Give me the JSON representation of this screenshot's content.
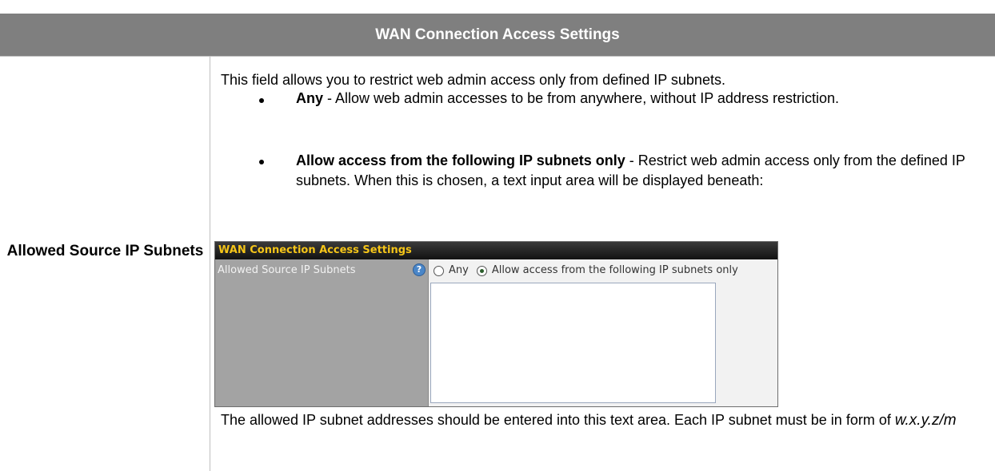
{
  "section_title": "WAN Connection Access Settings",
  "field_label": "Allowed Source IP Subnets",
  "intro": "This field allows you to restrict web admin access only from defined IP subnets.",
  "options": [
    {
      "name": "Any",
      "desc": " - Allow web admin accesses to be from anywhere, without IP address restriction."
    },
    {
      "name": "Allow access from the following IP subnets only",
      "desc": " - Restrict web admin access only from the defined IP subnets.  When this is chosen, a text input area will be displayed beneath:"
    }
  ],
  "screenshot": {
    "header": "WAN Connection Access Settings",
    "label": "Allowed Source IP Subnets",
    "help_icon": "question-mark-icon",
    "radio_any": "Any",
    "radio_allow": "Allow access from the following IP subnets only",
    "selected": "Allow access from the following IP subnets only",
    "textarea_value": ""
  },
  "after_text": "The allowed IP subnet addresses should be entered into this text area.  Each IP subnet must be in form of ",
  "after_format": "w.x.y.z/m"
}
